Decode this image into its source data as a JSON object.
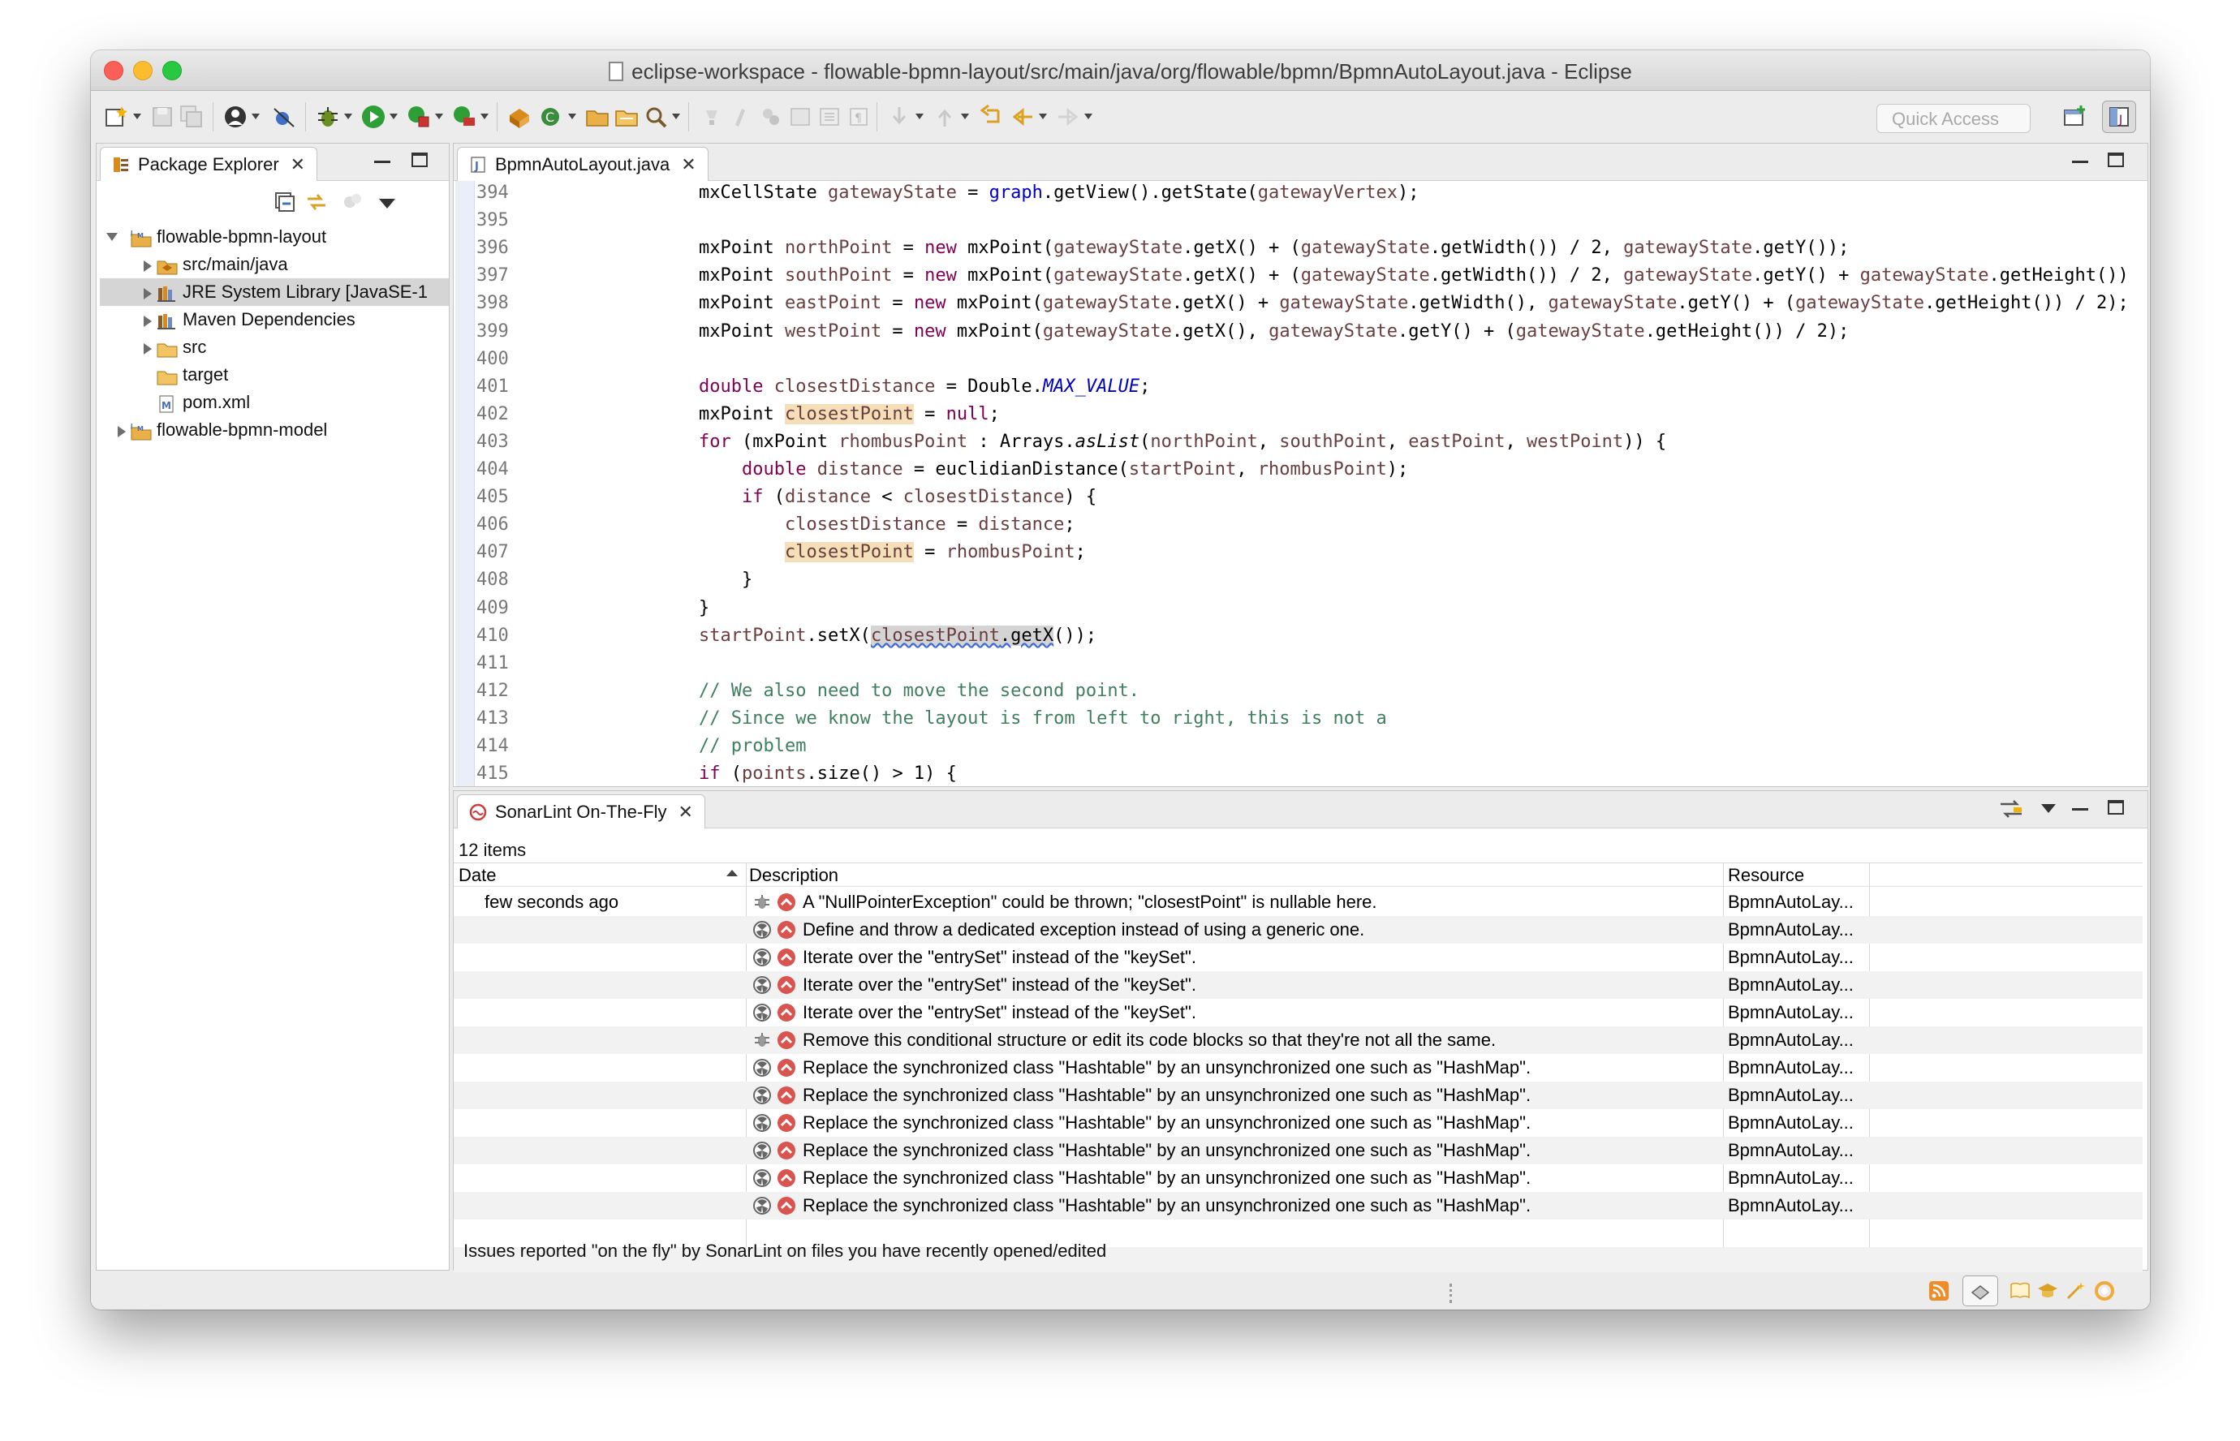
{
  "window": {
    "title": "eclipse-workspace - flowable-bpmn-layout/src/main/java/org/flowable/bpmn/BpmnAutoLayout.java - Eclipse"
  },
  "toolbar": {
    "quick_access_placeholder": "Quick Access"
  },
  "package_explorer": {
    "tab_label": "Package Explorer",
    "tree": [
      {
        "label": "flowable-bpmn-layout",
        "depth": 0,
        "expanded": true,
        "icon": "project-icon"
      },
      {
        "label": "src/main/java",
        "depth": 1,
        "expanded": false,
        "icon": "source-folder-icon"
      },
      {
        "label": "JRE System Library [JavaSE-1",
        "depth": 1,
        "expanded": false,
        "icon": "library-icon",
        "selected": true
      },
      {
        "label": "Maven Dependencies",
        "depth": 1,
        "expanded": false,
        "icon": "library-icon"
      },
      {
        "label": "src",
        "depth": 1,
        "expanded": false,
        "icon": "folder-icon"
      },
      {
        "label": "target",
        "depth": 1,
        "expanded": null,
        "icon": "folder-icon"
      },
      {
        "label": "pom.xml",
        "depth": 1,
        "expanded": null,
        "icon": "maven-pom-icon"
      },
      {
        "label": "flowable-bpmn-model",
        "depth": 0,
        "expanded": false,
        "icon": "project-icon"
      }
    ]
  },
  "editor": {
    "tab_label": "BpmnAutoLayout.java",
    "lines": [
      {
        "n": "394",
        "t": "mxCellState gatewayState = graph.getView().getState(gatewayVertex);"
      },
      {
        "n": "395",
        "t": ""
      },
      {
        "n": "396",
        "t": "mxPoint northPoint = new mxPoint(gatewayState.getX() + (gatewayState.getWidth()) / 2, gatewayState.getY());"
      },
      {
        "n": "397",
        "t": "mxPoint southPoint = new mxPoint(gatewayState.getX() + (gatewayState.getWidth()) / 2, gatewayState.getY() + gatewayState.getHeight())"
      },
      {
        "n": "398",
        "t": "mxPoint eastPoint = new mxPoint(gatewayState.getX() + gatewayState.getWidth(), gatewayState.getY() + (gatewayState.getHeight()) / 2);"
      },
      {
        "n": "399",
        "t": "mxPoint westPoint = new mxPoint(gatewayState.getX(), gatewayState.getY() + (gatewayState.getHeight()) / 2);"
      },
      {
        "n": "400",
        "t": ""
      },
      {
        "n": "401",
        "t": "double closestDistance = Double.MAX_VALUE;"
      },
      {
        "n": "402",
        "t": "mxPoint closestPoint = null;"
      },
      {
        "n": "403",
        "t": "for (mxPoint rhombusPoint : Arrays.asList(northPoint, southPoint, eastPoint, westPoint)) {"
      },
      {
        "n": "404",
        "t": "    double distance = euclidianDistance(startPoint, rhombusPoint);"
      },
      {
        "n": "405",
        "t": "    if (distance < closestDistance) {"
      },
      {
        "n": "406",
        "t": "        closestDistance = distance;"
      },
      {
        "n": "407",
        "t": "        closestPoint = rhombusPoint;"
      },
      {
        "n": "408",
        "t": "    }"
      },
      {
        "n": "409",
        "t": "}"
      },
      {
        "n": "410",
        "t": "startPoint.setX(closestPoint.getX());"
      },
      {
        "n": "411",
        "t": ""
      },
      {
        "n": "412",
        "t": "// We also need to move the second point."
      },
      {
        "n": "413",
        "t": "// Since we know the layout is from left to right, this is not a"
      },
      {
        "n": "414",
        "t": "// problem"
      },
      {
        "n": "415",
        "t": "if (points.size() > 1) {"
      }
    ]
  },
  "sonarlint": {
    "tab_label": "SonarLint On-The-Fly",
    "items_count": "12 items",
    "columns": {
      "date": "Date",
      "description": "Description",
      "resource": "Resource"
    },
    "issues": [
      {
        "date": "few seconds ago",
        "type": "bug",
        "description": "A \"NullPointerException\" could be thrown; \"closestPoint\" is nullable here.",
        "resource": "BpmnAutoLay..."
      },
      {
        "date": "",
        "type": "code-smell",
        "description": "Define and throw a dedicated exception instead of using a generic one.",
        "resource": "BpmnAutoLay..."
      },
      {
        "date": "",
        "type": "code-smell",
        "description": "Iterate over the \"entrySet\" instead of the \"keySet\".",
        "resource": "BpmnAutoLay..."
      },
      {
        "date": "",
        "type": "code-smell",
        "description": "Iterate over the \"entrySet\" instead of the \"keySet\".",
        "resource": "BpmnAutoLay..."
      },
      {
        "date": "",
        "type": "code-smell",
        "description": "Iterate over the \"entrySet\" instead of the \"keySet\".",
        "resource": "BpmnAutoLay..."
      },
      {
        "date": "",
        "type": "bug",
        "description": "Remove this conditional structure or edit its code blocks so that they're not all the same.",
        "resource": "BpmnAutoLay..."
      },
      {
        "date": "",
        "type": "code-smell",
        "description": "Replace the synchronized class \"Hashtable\" by an unsynchronized one such as \"HashMap\".",
        "resource": "BpmnAutoLay..."
      },
      {
        "date": "",
        "type": "code-smell",
        "description": "Replace the synchronized class \"Hashtable\" by an unsynchronized one such as \"HashMap\".",
        "resource": "BpmnAutoLay..."
      },
      {
        "date": "",
        "type": "code-smell",
        "description": "Replace the synchronized class \"Hashtable\" by an unsynchronized one such as \"HashMap\".",
        "resource": "BpmnAutoLay..."
      },
      {
        "date": "",
        "type": "code-smell",
        "description": "Replace the synchronized class \"Hashtable\" by an unsynchronized one such as \"HashMap\".",
        "resource": "BpmnAutoLay..."
      },
      {
        "date": "",
        "type": "code-smell",
        "description": "Replace the synchronized class \"Hashtable\" by an unsynchronized one such as \"HashMap\".",
        "resource": "BpmnAutoLay..."
      },
      {
        "date": "",
        "type": "code-smell",
        "description": "Replace the synchronized class \"Hashtable\" by an unsynchronized one such as \"HashMap\".",
        "resource": "BpmnAutoLay..."
      }
    ],
    "status_text": "Issues reported \"on the fly\" by SonarLint on files you have recently opened/edited"
  },
  "colors": {
    "keyword": "#7f0055",
    "field": "#0000c0",
    "comment": "#3f7f5f",
    "occurrence_highlight": "#f4dfb8",
    "severity_major": "#d9534f"
  }
}
